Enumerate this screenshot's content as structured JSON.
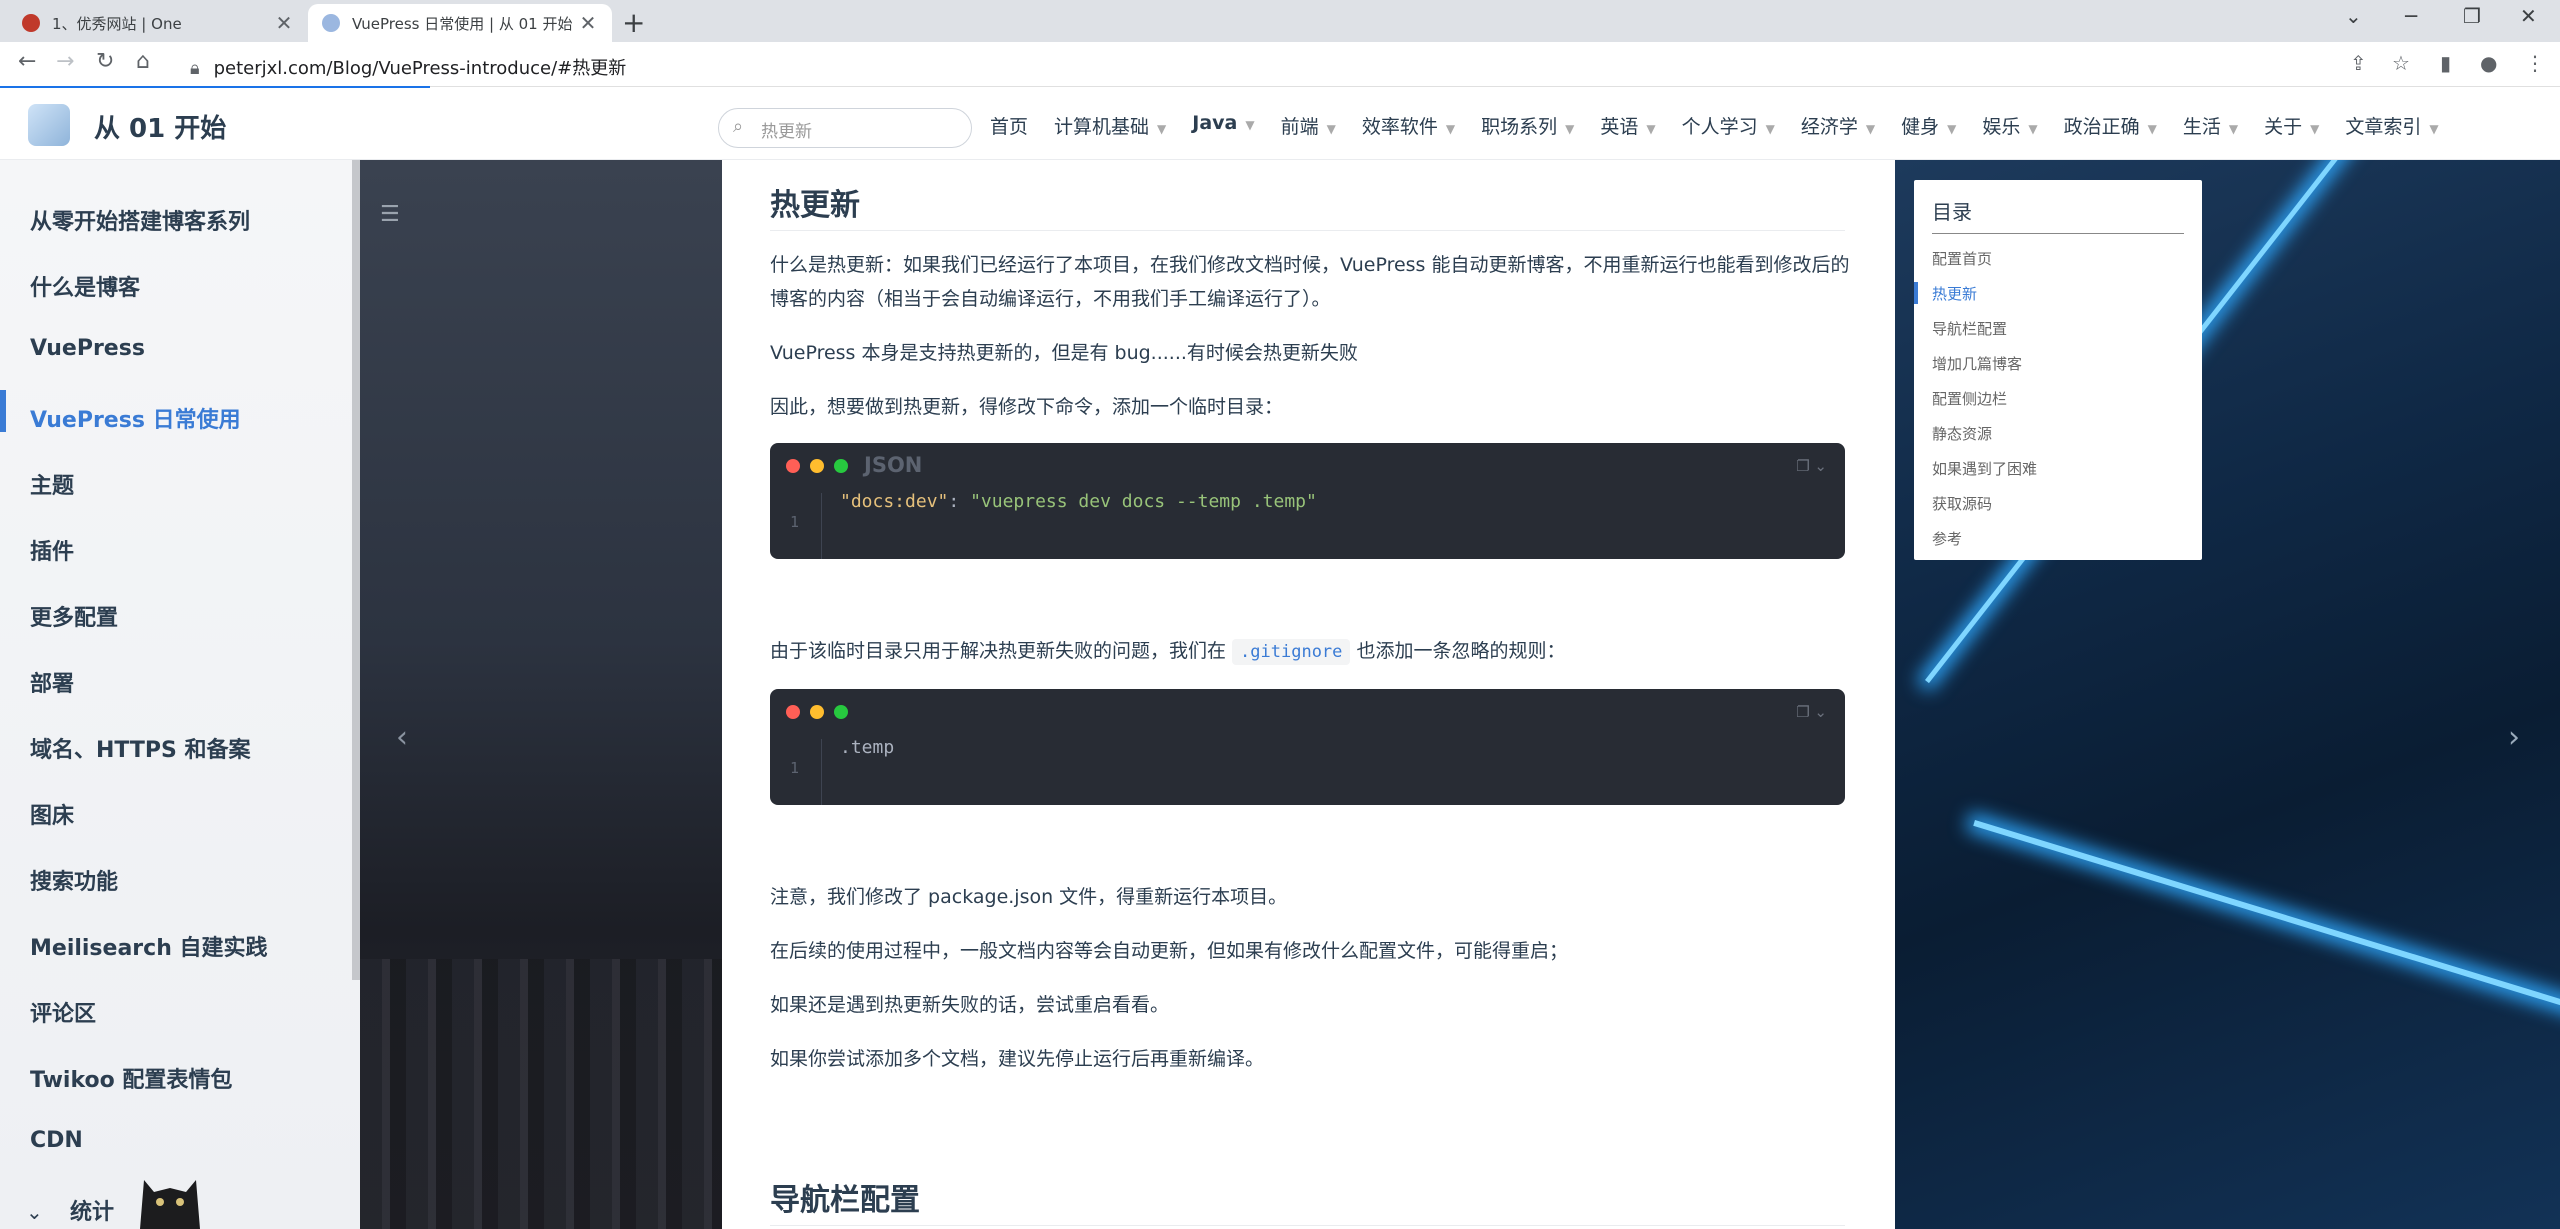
{
  "browser": {
    "tabs": [
      {
        "title": "1、优秀网站 | One",
        "close": "✕",
        "active": false
      },
      {
        "title": "VuePress 日常使用 | 从 01 开始",
        "close": "✕",
        "active": true
      }
    ],
    "new_tab": "+",
    "url": "peterjxl.com/Blog/VuePress-introduce/#热更新"
  },
  "navbar": {
    "site_title": "从 01 开始",
    "search_placeholder": "热更新",
    "links": [
      {
        "label": "首页",
        "dropdown": false
      },
      {
        "label": "计算机基础",
        "dropdown": true
      },
      {
        "label": "Java",
        "dropdown": true
      },
      {
        "label": "前端",
        "dropdown": true
      },
      {
        "label": "效率软件",
        "dropdown": true
      },
      {
        "label": "职场系列",
        "dropdown": true
      },
      {
        "label": "英语",
        "dropdown": true
      },
      {
        "label": "个人学习",
        "dropdown": true
      },
      {
        "label": "经济学",
        "dropdown": true
      },
      {
        "label": "健身",
        "dropdown": true
      },
      {
        "label": "娱乐",
        "dropdown": true
      },
      {
        "label": "政治正确",
        "dropdown": true
      },
      {
        "label": "生活",
        "dropdown": true
      },
      {
        "label": "关于",
        "dropdown": true
      },
      {
        "label": "文章索引",
        "dropdown": true
      }
    ]
  },
  "sidebar": {
    "items": [
      "从零开始搭建博客系列",
      "什么是博客",
      "VuePress",
      "VuePress 日常使用",
      "主题",
      "插件",
      "更多配置",
      "部署",
      "域名、HTTPS 和备案",
      "图床",
      "搜索功能",
      "Meilisearch 自建实践",
      "评论区",
      "Twikoo 配置表情包",
      "CDN",
      "统计"
    ],
    "active_index": 3
  },
  "toc": {
    "title": "目录",
    "items": [
      "配置首页",
      "热更新",
      "导航栏配置",
      "增加几篇博客",
      "配置侧边栏",
      "静态资源",
      "如果遇到了困难",
      "获取源码",
      "参考"
    ],
    "active_index": 1
  },
  "content": {
    "heading1": "热更新",
    "p1": "什么是热更新：如果我们已经运行了本项目，在我们修改文档时候，VuePress 能自动更新博客，不用重新运行也能看到修改后的博客的内容（相当于会自动编译运行，不用我们手工编译运行了）。",
    "p2": "VuePress 本身是支持热更新的，但是有 bug......有时候会热更新失败",
    "p3": "因此，想要做到热更新，得修改下命令，添加一个临时目录：",
    "code1": {
      "lang": "JSON",
      "line_no": "1",
      "key": "\"docs:dev\"",
      "sep": ": ",
      "value": "\"vuepress dev docs --temp .temp\""
    },
    "p4_before": "由于该临时目录只用于解决热更新失败的问题，我们在 ",
    "p4_code": ".gitignore",
    "p4_after": " 也添加一条忽略的规则：",
    "code2": {
      "line_no": "1",
      "text": ".temp"
    },
    "p5": "注意，我们修改了 package.json 文件，得重新运行本项目。",
    "p6": "在后续的使用过程中，一般文档内容等会自动更新，但如果有修改什么配置文件，可能得重启；",
    "p7": "如果还是遇到热更新失败的话，尝试重启看看。",
    "p8": "如果你尝试添加多个文档，建议先停止运行后再重新编译。",
    "heading2": "导航栏配置"
  },
  "colors": {
    "accent": "#3a7bd5",
    "code_bg": "#282c34",
    "dot_red": "#ff5f56",
    "dot_yellow": "#ffbd2e",
    "dot_green": "#27c93f"
  }
}
